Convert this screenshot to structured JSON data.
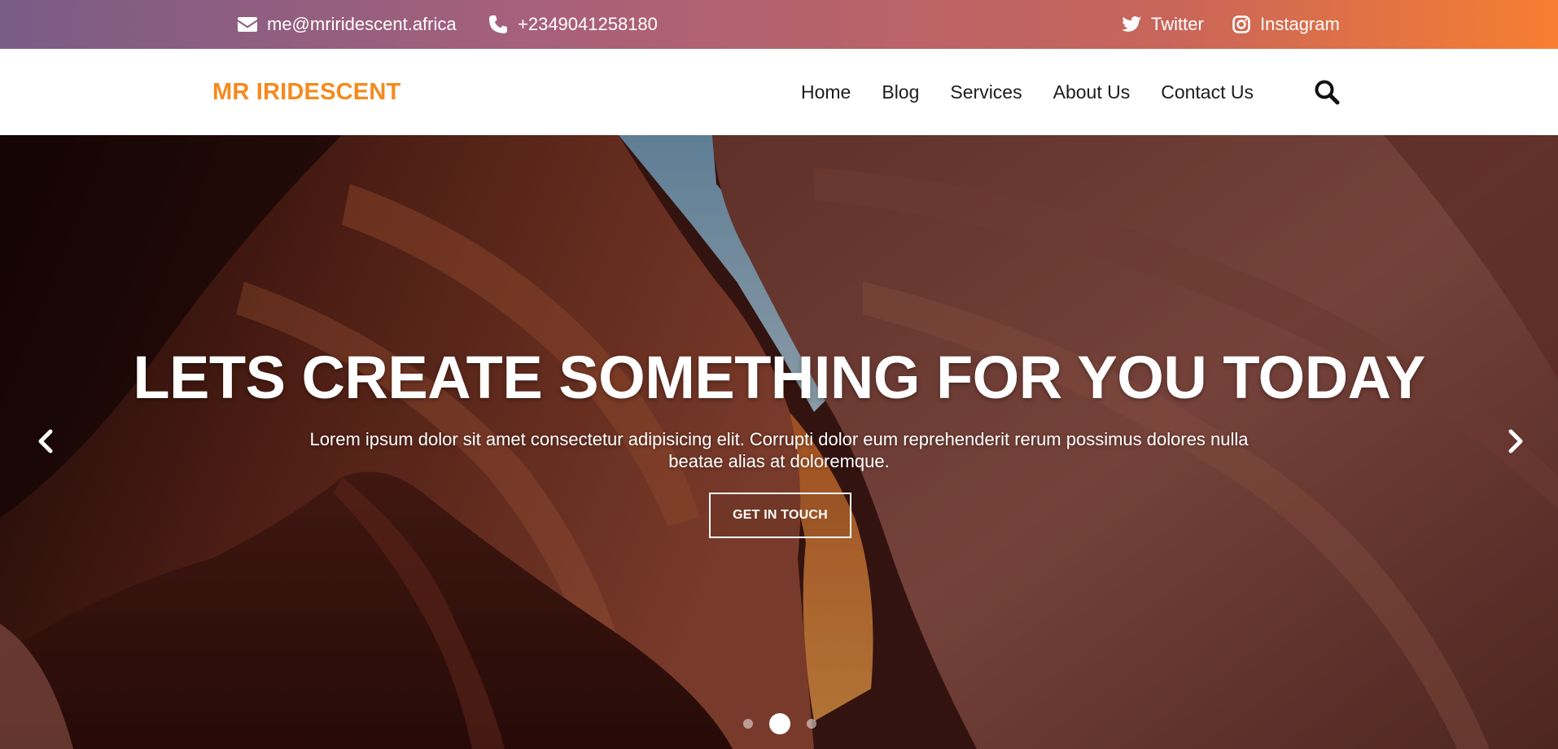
{
  "topbar": {
    "email": "me@mriridescent.africa",
    "phone": "+2349041258180",
    "twitter": "Twitter",
    "instagram": "Instagram",
    "icons": [
      "envelope-icon",
      "phone-icon",
      "twitter-icon",
      "instagram-icon"
    ]
  },
  "nav": {
    "brand": "MR IRIDESCENT",
    "links": [
      "Home",
      "Blog",
      "Services",
      "About Us",
      "Contact Us"
    ],
    "search_icon": "search-icon"
  },
  "hero": {
    "title": "LETS CREATE SOMETHING FOR YOU TODAY",
    "text": "Lorem ipsum dolor sit amet consectetur adipisicing elit. Corrupti dolor eum reprehenderit rerum possimus dolores nulla beatae alias at doloremque.",
    "cta": "GET IN TOUCH",
    "slide_count": 3,
    "active_slide": 2
  },
  "colors": {
    "brand": "#f48a1e",
    "topbar_start": "#7a5c86",
    "topbar_end": "#f77e31",
    "nav_text": "#1c1c1c",
    "hero_text": "#ffffff"
  }
}
